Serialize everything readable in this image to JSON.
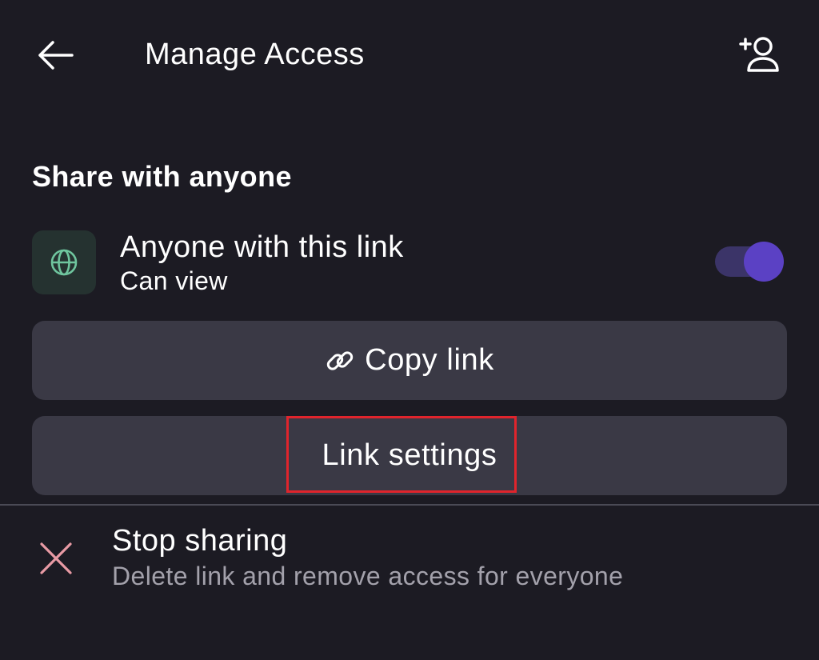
{
  "header": {
    "title": "Manage Access",
    "back_icon": "arrow-left-icon",
    "add_member_icon": "person-add-icon"
  },
  "share": {
    "section_title": "Share with anyone",
    "link_access": {
      "title": "Anyone with this link",
      "permission": "Can view",
      "icon": "globe-icon",
      "toggle_on": true
    },
    "copy_link_label": "Copy link",
    "copy_link_icon": "link-icon",
    "link_settings_label": "Link settings"
  },
  "stop_sharing": {
    "title": "Stop sharing",
    "description": "Delete link and remove access for everyone",
    "icon": "close-icon"
  },
  "colors": {
    "background": "#1c1b23",
    "button_bg": "#3a3945",
    "accent": "#5b41c4",
    "globe_tile": "#253230",
    "globe_icon": "#6fc59e",
    "danger_icon": "#e89aa4",
    "highlight": "#e0242c"
  }
}
